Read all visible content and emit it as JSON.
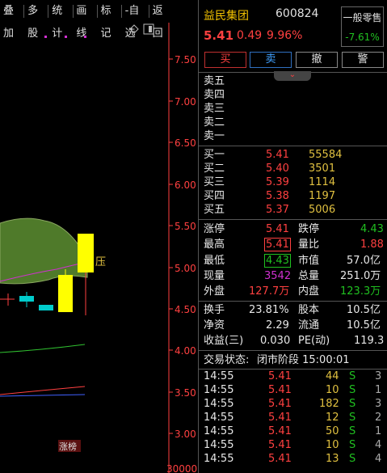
{
  "toolbar": {
    "items": [
      "叠加",
      "多股",
      "统计",
      "画线",
      "标记",
      "-自选",
      "返回"
    ]
  },
  "chart": {
    "price_labels": [
      "7.50",
      "7.00",
      "6.50",
      "6.00",
      "5.50",
      "5.00",
      "4.50",
      "4.00",
      "3.50",
      "3.00"
    ],
    "bottom_label": "30000",
    "pressure_label": "压",
    "limit_up_tag": "涨榜",
    "colors": {
      "up": "#ffff00",
      "down": "#00cccc",
      "cloud": "#4f7a2a",
      "axis": "#ff4040"
    }
  },
  "header": {
    "name": "益民集团",
    "code": "600824",
    "price": "5.41",
    "change": "0.49",
    "change_pct": "9.96%",
    "tag_label": "一般零售",
    "tag_pct": "-7.61%"
  },
  "actions": {
    "buy": "买",
    "sell": "卖",
    "cancel": "撤",
    "alert": "警"
  },
  "order_book": {
    "asks": [
      {
        "label": "卖五",
        "price": "",
        "vol": ""
      },
      {
        "label": "卖四",
        "price": "",
        "vol": ""
      },
      {
        "label": "卖三",
        "price": "",
        "vol": ""
      },
      {
        "label": "卖二",
        "price": "",
        "vol": ""
      },
      {
        "label": "卖一",
        "price": "",
        "vol": ""
      }
    ],
    "bids": [
      {
        "label": "买一",
        "price": "5.41",
        "vol": "55584"
      },
      {
        "label": "买二",
        "price": "5.40",
        "vol": "3501"
      },
      {
        "label": "买三",
        "price": "5.39",
        "vol": "1114"
      },
      {
        "label": "买四",
        "price": "5.38",
        "vol": "1197"
      },
      {
        "label": "买五",
        "price": "5.37",
        "vol": "5006"
      }
    ]
  },
  "stats": {
    "limit_up_label": "涨停",
    "limit_up": "5.41",
    "limit_down_label": "跌停",
    "limit_down": "4.43",
    "high_label": "最高",
    "high": "5.41",
    "vol_ratio_label": "量比",
    "vol_ratio": "1.88",
    "low_label": "最低",
    "low": "4.43",
    "mkt_cap_label": "市值",
    "mkt_cap": "57.0亿",
    "now_vol_label": "现量",
    "now_vol": "3542",
    "total_vol_label": "总量",
    "total_vol": "251.0万",
    "outer_label": "外盘",
    "outer": "127.7万",
    "inner_label": "内盘",
    "inner": "123.3万",
    "turnover_label": "换手",
    "turnover": "23.81%",
    "equity_label": "股本",
    "equity": "10.5亿",
    "nav_label": "净资",
    "nav": "2.29",
    "float_label": "流通",
    "float": "10.5亿",
    "eps_label": "收益(三)",
    "eps": "0.030",
    "pe_label": "PE(动)",
    "pe": "119.3"
  },
  "status": {
    "label": "交易状态:",
    "value": "闭市阶段 15:00:01"
  },
  "ticks": [
    {
      "time": "14:55",
      "price": "5.41",
      "vol": "44",
      "side": "S",
      "count": "3"
    },
    {
      "time": "14:55",
      "price": "5.41",
      "vol": "10",
      "side": "S",
      "count": "1"
    },
    {
      "time": "14:55",
      "price": "5.41",
      "vol": "182",
      "side": "S",
      "count": "3"
    },
    {
      "time": "14:55",
      "price": "5.41",
      "vol": "12",
      "side": "S",
      "count": "2"
    },
    {
      "time": "14:55",
      "price": "5.41",
      "vol": "50",
      "side": "S",
      "count": "1"
    },
    {
      "time": "14:55",
      "price": "5.41",
      "vol": "10",
      "side": "S",
      "count": "4"
    },
    {
      "time": "14:55",
      "price": "5.41",
      "vol": "13",
      "side": "S",
      "count": "4"
    }
  ]
}
